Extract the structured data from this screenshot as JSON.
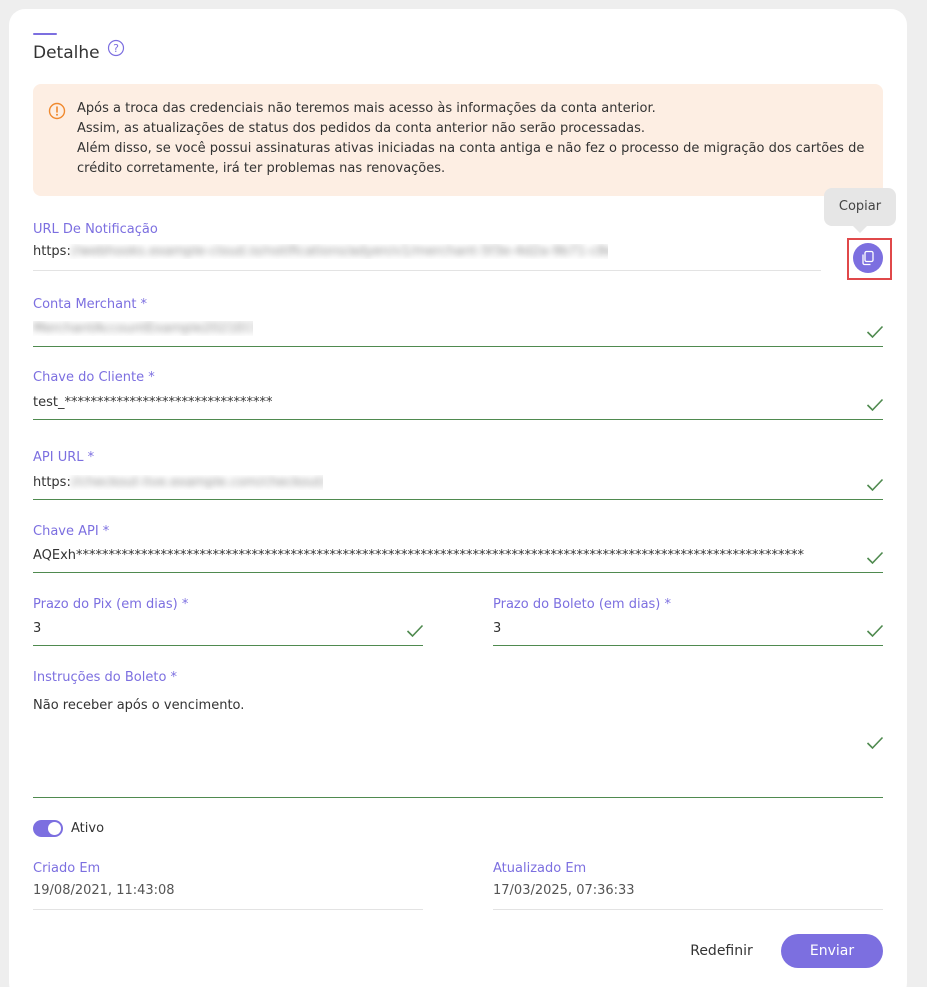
{
  "header": {
    "title": "Detalhe"
  },
  "alert": {
    "lines": [
      "Após a troca das credenciais não teremos mais acesso às informações da conta anterior.",
      "Assim, as atualizações de status dos pedidos da conta anterior não serão processadas.",
      "Além disso, se você possui assinaturas ativas iniciadas na conta antiga e não fez o processo de migração dos cartões de",
      "crédito corretamente, irá ter problemas nas renovações."
    ]
  },
  "tooltip": {
    "text": "Copiar"
  },
  "fields": {
    "notification_url": {
      "label": "URL De Notificação",
      "value_prefix": "https:",
      "value_redacted": "//webhooks.example-cloud.io/notifications/adyen/v1/merchant-5f3e-4d2a-9b71-c8e0a1b2c3d4"
    },
    "merchant_account": {
      "label": "Conta Merchant *",
      "value_redacted": "MerchantAccountExample2021ECOM"
    },
    "client_key": {
      "label": "Chave do Cliente *",
      "value": "test_********************************"
    },
    "api_url": {
      "label": "API URL *",
      "value_prefix": "https:",
      "value_redacted": "//checkout-live.example.com/checkout/v68"
    },
    "api_key": {
      "label": "Chave API *",
      "value": "AQExh****************************************************************************************************************"
    },
    "pix_deadline": {
      "label": "Prazo do Pix (em dias) *",
      "value": "3"
    },
    "boleto_deadline": {
      "label": "Prazo do Boleto (em dias) *",
      "value": "3"
    },
    "boleto_instructions": {
      "label": "Instruções do Boleto *",
      "value": "Não receber após o vencimento."
    }
  },
  "status": {
    "toggle_label": "Ativo",
    "active": true
  },
  "meta": {
    "created_label": "Criado Em",
    "created_value": "19/08/2021, 11:43:08",
    "updated_label": "Atualizado Em",
    "updated_value": "17/03/2025, 07:36:33"
  },
  "actions": {
    "reset_label": "Redefinir",
    "submit_label": "Enviar"
  },
  "colors": {
    "accent": "#7c6fe0",
    "valid": "#4f8a4f",
    "alert_bg": "#fdeee3",
    "alert_icon": "#f0892e",
    "highlight": "#e0484a"
  }
}
